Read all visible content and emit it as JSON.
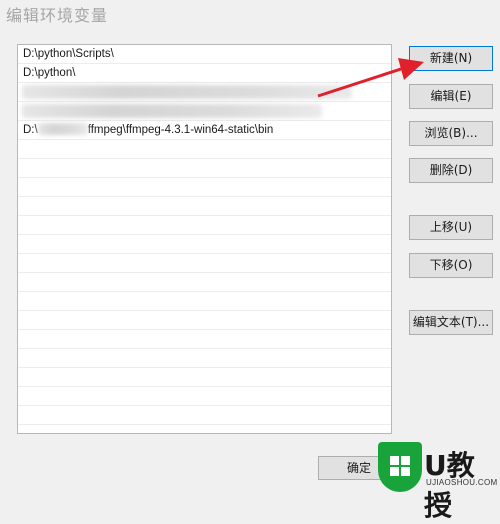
{
  "window": {
    "title": "编辑环境变量"
  },
  "list": {
    "items": [
      {
        "text": "D:\\python\\Scripts\\"
      },
      {
        "text": "D:\\python\\"
      },
      {
        "text": ""
      },
      {
        "text": ""
      },
      {
        "text": "D:\\",
        "suffix": "ffmpeg\\ffmpeg-4.3.1-win64-static\\bin"
      }
    ]
  },
  "buttons": {
    "new": "新建(N)",
    "edit": "编辑(E)",
    "browse": "浏览(B)...",
    "delete": "删除(D)",
    "move_up": "上移(U)",
    "move_down": "下移(O)",
    "edit_text": "编辑文本(T)...",
    "ok": "确定"
  },
  "watermark": {
    "text": "U教授",
    "url": "UJIAOSHOU.COM"
  },
  "colors": {
    "arrow": "#e0202a",
    "logo_green": "#18a33b",
    "focus_border": "#0078d7"
  }
}
